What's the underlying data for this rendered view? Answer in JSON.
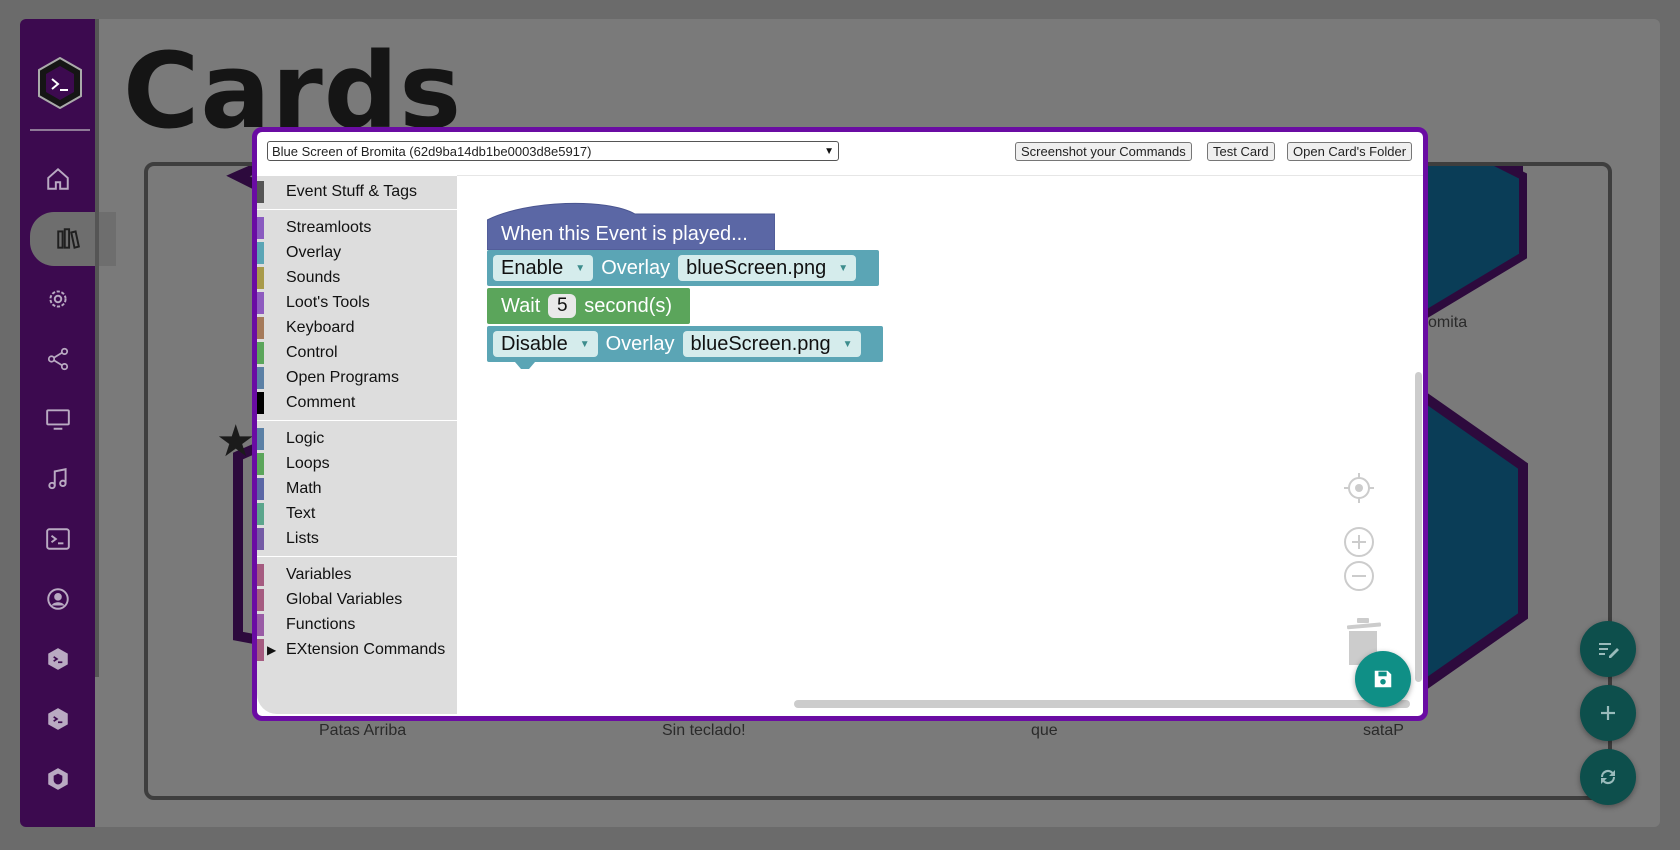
{
  "page": {
    "title": "Cards",
    "card_names": [
      "Patas Arriba",
      "Sin teclado!",
      "que",
      "sataP",
      "omita"
    ]
  },
  "sidebar": {
    "items": [
      {
        "icon": "home-icon"
      },
      {
        "icon": "library-icon",
        "active": true
      },
      {
        "icon": "settings-icon"
      },
      {
        "icon": "share-icon"
      },
      {
        "icon": "monitor-icon"
      },
      {
        "icon": "music-icon"
      },
      {
        "icon": "terminal-icon"
      },
      {
        "icon": "account-icon"
      },
      {
        "icon": "hexagon-terminal-icon"
      },
      {
        "icon": "hexagon-terminal-icon"
      },
      {
        "icon": "hexagon-shield-icon"
      }
    ]
  },
  "fabs": [
    {
      "icon": "edit-list-icon"
    },
    {
      "icon": "plus-icon"
    },
    {
      "icon": "sync-icon"
    }
  ],
  "modal": {
    "select_value": "Blue Screen of Bromita (62d9ba14db1be0003d8e5917)",
    "buttons": {
      "screenshot": "Screenshot your Commands",
      "test": "Test Card",
      "folder": "Open Card's Folder"
    },
    "toolbox": {
      "groups": [
        [
          {
            "label": "Event Stuff & Tags",
            "color": "#555555"
          }
        ],
        [
          {
            "label": "Streamloots",
            "color": "#8a5bc0"
          },
          {
            "label": "Overlay",
            "color": "#5ba5b5"
          },
          {
            "label": "Sounds",
            "color": "#a89a4a"
          },
          {
            "label": "Loot's Tools",
            "color": "#8e5bbf"
          },
          {
            "label": "Keyboard",
            "color": "#a57a5a"
          },
          {
            "label": "Control",
            "color": "#5ba55b"
          },
          {
            "label": "Open Programs",
            "color": "#5b80a5"
          },
          {
            "label": "Comment",
            "color": "#000000"
          }
        ],
        [
          {
            "label": "Logic",
            "color": "#5b80a5"
          },
          {
            "label": "Loops",
            "color": "#5ba55b"
          },
          {
            "label": "Math",
            "color": "#5b67a5"
          },
          {
            "label": "Text",
            "color": "#5ba58c"
          },
          {
            "label": "Lists",
            "color": "#745ba5"
          }
        ],
        [
          {
            "label": "Variables",
            "color": "#a55b80"
          },
          {
            "label": "Global Variables",
            "color": "#a55b80"
          },
          {
            "label": "Functions",
            "color": "#995ba5"
          },
          {
            "label": "EXtension Commands",
            "color": "#a55b80",
            "expandable": true
          }
        ]
      ]
    },
    "blocks": {
      "hat": "When this Event is played...",
      "enable": {
        "action": "Enable",
        "label": "Overlay",
        "file": "blueScreen.png"
      },
      "wait": {
        "label": "Wait",
        "value": "5",
        "unit": "second(s)"
      },
      "disable": {
        "action": "Disable",
        "label": "Overlay",
        "file": "blueScreen.png"
      }
    },
    "colors": {
      "hat": "#5b67a5",
      "overlay": "#5ba5b5",
      "wait": "#5ba55b",
      "save": "#0f8f86"
    }
  }
}
